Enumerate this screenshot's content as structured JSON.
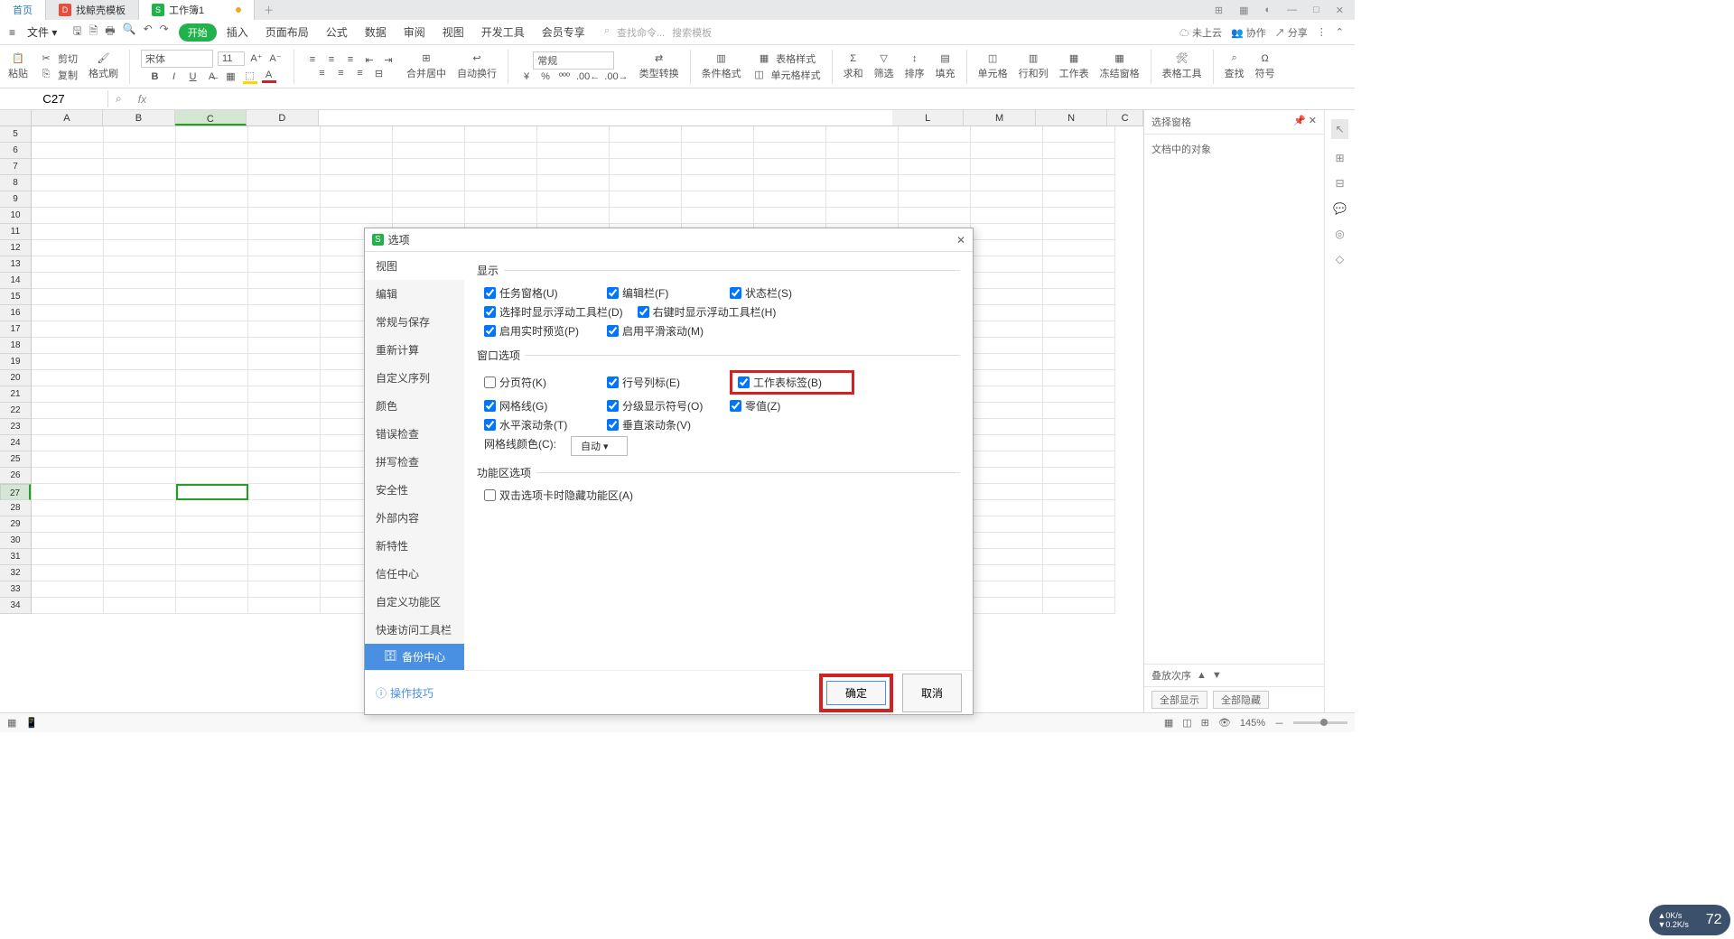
{
  "tabs": {
    "home": "首页",
    "t1": "找鲸壳模板",
    "t2": "工作簿1"
  },
  "file": "文件",
  "menu": [
    "开始",
    "插入",
    "页面布局",
    "公式",
    "数据",
    "审阅",
    "视图",
    "开发工具",
    "会员专享"
  ],
  "search": {
    "p1": "查找命令...",
    "p2": "搜索模板"
  },
  "cloud": [
    "未上云",
    "协作",
    "分享"
  ],
  "ribbon": {
    "paste": "粘贴",
    "cut": "剪切",
    "copy": "复制",
    "format": "格式刷",
    "font": "宋体",
    "size": "11",
    "merge": "合并居中",
    "wrap": "自动换行",
    "numfmt": "常规",
    "typeconv": "类型转换",
    "condfmt": "条件格式",
    "tblstyle": "表格样式",
    "cellstyle": "单元格样式",
    "sum": "求和",
    "filter": "筛选",
    "sort": "排序",
    "fill": "填充",
    "cell": "单元格",
    "rowcol": "行和列",
    "sheet": "工作表",
    "freeze": "冻结窗格",
    "tools": "表格工具",
    "find": "查找",
    "symbol": "符号"
  },
  "namebox": "C27",
  "cols": [
    "A",
    "B",
    "C",
    "D",
    "L",
    "M",
    "N",
    "C"
  ],
  "rowstart": 5,
  "rowend": 34,
  "panel": {
    "title": "选择窗格",
    "sub": "文档中的对象",
    "foot": "叠放次序",
    "b1": "全部显示",
    "b2": "全部隐藏"
  },
  "dialog": {
    "title": "选项",
    "nav": [
      "视图",
      "编辑",
      "常规与保存",
      "重新计算",
      "自定义序列",
      "颜色",
      "错误检查",
      "拼写检查",
      "安全性",
      "外部内容",
      "新特性",
      "信任中心",
      "自定义功能区",
      "快速访问工具栏"
    ],
    "backup": "备份中心",
    "sect1": "显示",
    "opts1": [
      [
        "任务窗格(U)",
        "编辑栏(F)",
        "状态栏(S)"
      ],
      [
        "选择时显示浮动工具栏(D)",
        "右键时显示浮动工具栏(H)",
        ""
      ],
      [
        "启用实时预览(P)",
        "启用平滑滚动(M)",
        ""
      ]
    ],
    "sect2": "窗口选项",
    "opts2": [
      [
        "分页符(K)",
        "行号列标(E)",
        "工作表标签(B)"
      ],
      [
        "网格线(G)",
        "分级显示符号(O)",
        "零值(Z)"
      ],
      [
        "水平滚动条(T)",
        "垂直滚动条(V)",
        ""
      ]
    ],
    "gridlabel": "网格线颜色(C):",
    "gridval": "自动",
    "sect3": "功能区选项",
    "opts3": "双击选项卡时隐藏功能区(A)",
    "help": "操作技巧",
    "ok": "确定",
    "cancel": "取消"
  },
  "zoom": "145%"
}
